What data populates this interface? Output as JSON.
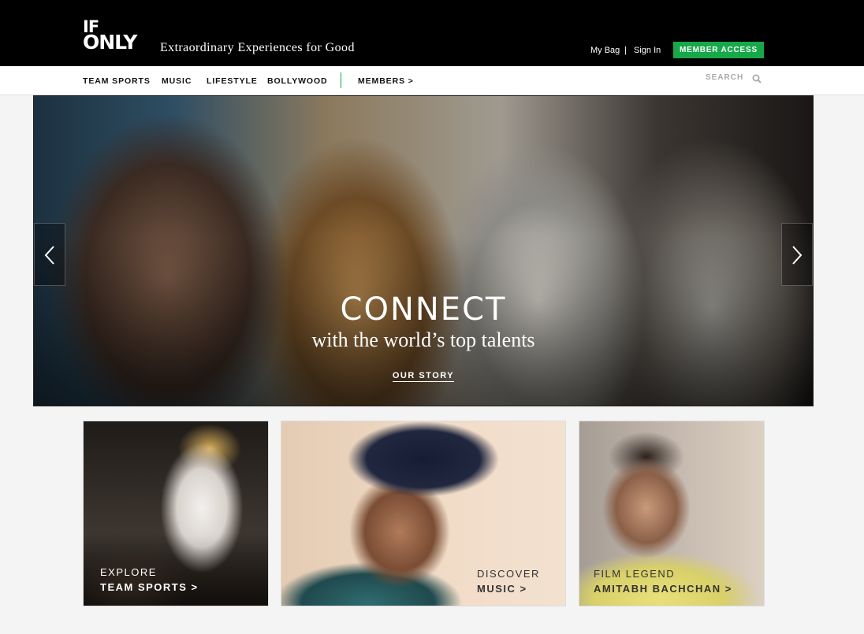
{
  "header": {
    "logo_line1": "IF",
    "logo_line2": "ONLY",
    "tagline": "Extraordinary Experiences for Good",
    "my_bag": "My Bag",
    "separator": "|",
    "sign_in": "Sign In",
    "member_access": "MEMBER ACCESS",
    "accent_color": "#17a84a"
  },
  "nav": {
    "items": [
      "TEAM SPORTS",
      "MUSIC",
      "LIFESTYLE",
      "BOLLYWOOD",
      "MEMBERS >"
    ],
    "search_label": "SEARCH",
    "search_icon": "search-icon"
  },
  "hero": {
    "title": "CONNECT",
    "subtitle": "with the world’s top talents",
    "link": "OUR STORY",
    "prev_icon": "chevron-left-icon",
    "next_icon": "chevron-right-icon"
  },
  "tiles": [
    {
      "kicker": "EXPLORE",
      "headline": "TEAM SPORTS >"
    },
    {
      "kicker": "DISCOVER",
      "headline": "MUSIC >"
    },
    {
      "kicker": "FILM LEGEND",
      "headline": "AMITABH BACHCHAN >"
    }
  ]
}
